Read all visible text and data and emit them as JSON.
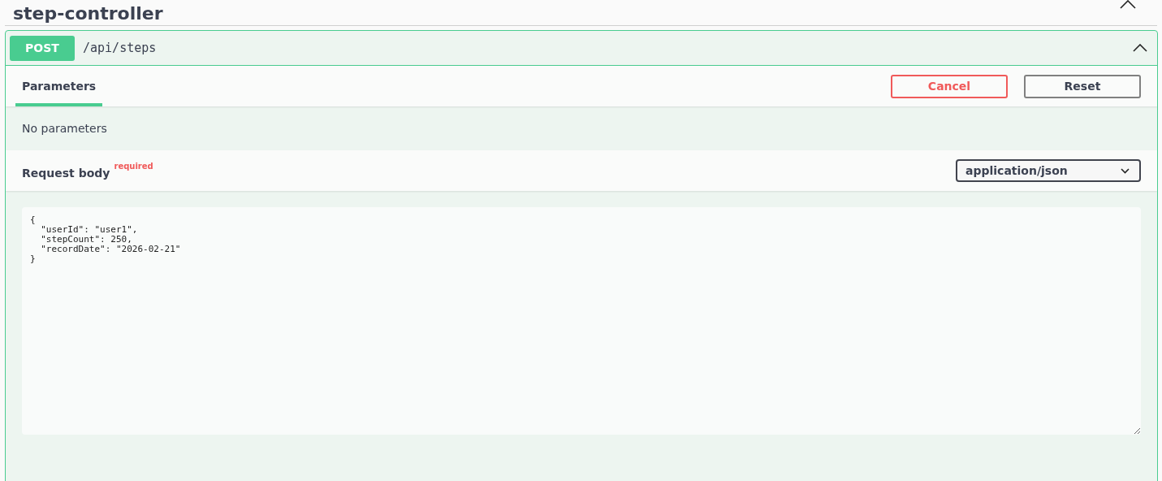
{
  "section": {
    "title": "step-controller",
    "expanded": true
  },
  "operation": {
    "method": "POST",
    "path": "/api/steps",
    "expanded": true
  },
  "tabs": [
    {
      "label": "Parameters",
      "selected": true
    }
  ],
  "buttons": [
    {
      "label": "Cancel",
      "kind": "cancel"
    },
    {
      "label": "Reset",
      "kind": "reset"
    }
  ],
  "parameters": {
    "message": "No parameters"
  },
  "request_body": {
    "label": "Request body",
    "required_badge": "required",
    "content_type": "application/json",
    "value": "{\n  \"userId\": \"user1\",\n  \"stepCount\": 250,\n  \"recordDate\": \"2026-02-21\"\n}"
  }
}
